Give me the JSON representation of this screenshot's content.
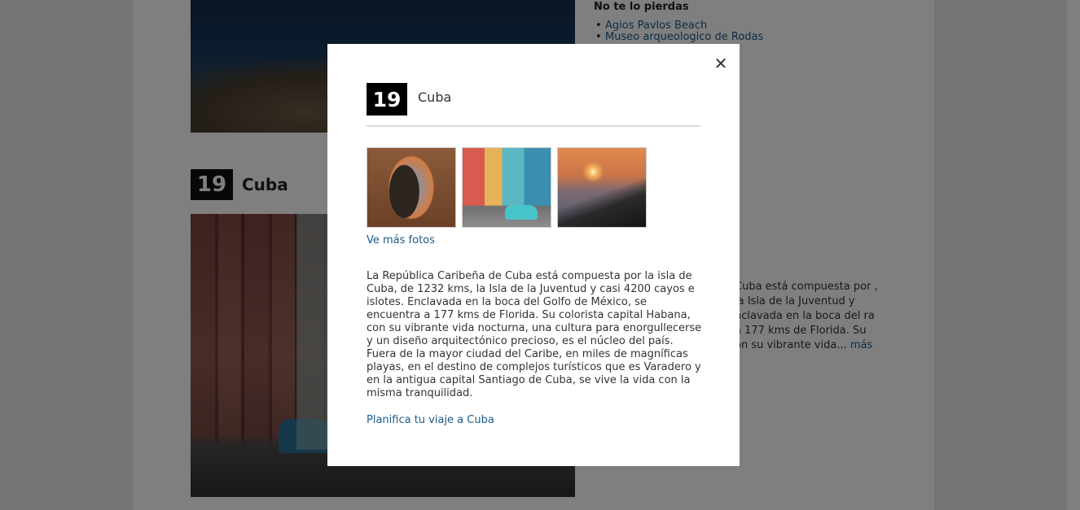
{
  "background": {
    "section_number": "19",
    "section_title": "Cuba",
    "side_heading": "No te lo pierdas",
    "side_list": [
      "Agios Pavlos Beach",
      "Museo arqueologico de Rodas"
    ],
    "side_excerpt": "Cuba está compuesta por , la Isla de la Juventud y nclavada en la boca del ra a 177 kms de Florida. Su on su vibrante vida...",
    "side_more": "más"
  },
  "modal": {
    "close_icon": "close-icon",
    "number": "19",
    "title": "Cuba",
    "thumbnails": [
      {
        "alt": "Viajero bajo arco mirando la ciudad"
      },
      {
        "alt": "Calle colorida de La Habana con coche clásico"
      },
      {
        "alt": "Playa al atardecer"
      }
    ],
    "more_photos": "Ve más fotos",
    "description": "La República Caribeña de Cuba está compuesta por la isla de Cuba, de 1232 kms, la Isla de la Juventud y casi 4200 cayos e islotes. Enclavada en la boca del Golfo de México, se encuentra a 177 kms de Florida. Su colorista capital Habana, con su vibrante vida nocturna, una cultura para enorgullecerse y un diseño arquitectónico precioso, es el núcleo del país. Fuera de la mayor ciudad del Caribe, en miles de magníficas playas, en el destino de complejos turísticos que es Varadero y en la antigua capital Santiago de Cuba, se vive la vida con la misma tranquilidad.",
    "plan_link": "Planifica tu viaje a Cuba"
  }
}
